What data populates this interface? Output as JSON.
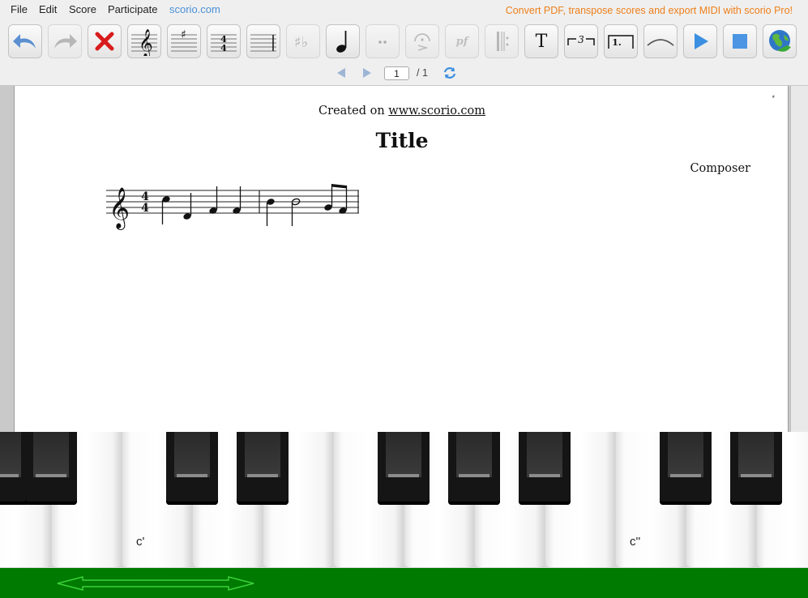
{
  "menu": {
    "file": "File",
    "edit": "Edit",
    "score": "Score",
    "participate": "Participate",
    "site_link": "scorio.com",
    "promo": "Convert PDF, transpose scores and export MIDI with scorio Pro!"
  },
  "toolbar": {
    "tools": [
      "undo",
      "redo",
      "delete",
      "clef",
      "key-signature",
      "time-signature",
      "barline",
      "accidentals",
      "note-value",
      "dots",
      "articulation",
      "dynamics",
      "repeat",
      "text",
      "tuplet",
      "volta",
      "slur",
      "play",
      "stop",
      "online"
    ],
    "time_sig_top": "4",
    "time_sig_bottom": "4",
    "text_tool_label": "T",
    "tuplet_label": "3",
    "volta_label": "1.",
    "dynamics_label": "pf"
  },
  "pager": {
    "current_page": "1",
    "total": "/ 1"
  },
  "score": {
    "created_prefix": "Created on ",
    "created_link": "www.scorio.com",
    "title": "Title",
    "composer": "Composer",
    "corner_mark": "*",
    "time_signature": "4/4",
    "clef": "treble",
    "notes": [
      "C5 quarter",
      "E4 quarter",
      "G4 quarter",
      "G4 quarter",
      "|",
      "B4 quarter",
      "B4 half",
      "G4 eighth",
      "G4 eighth"
    ]
  },
  "keyboard": {
    "label_c1": "c'",
    "label_c2": "c''"
  },
  "colors": {
    "promo": "#ee7f1a",
    "link": "#4a90d9",
    "bottom_bar": "#007a00",
    "play": "#3b8fe0"
  }
}
